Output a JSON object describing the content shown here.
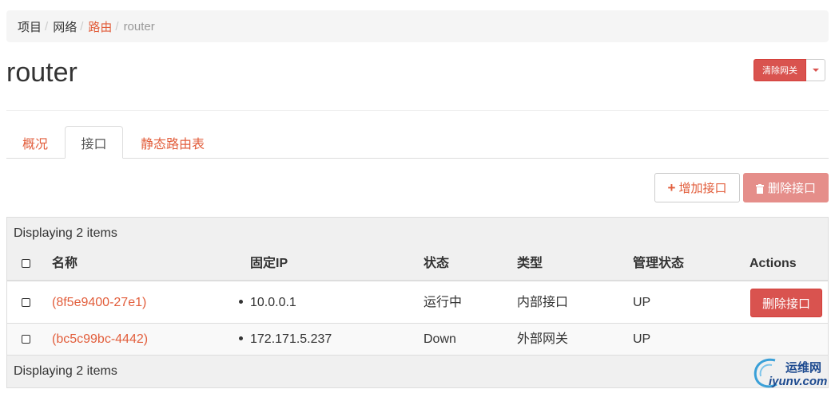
{
  "breadcrumb": {
    "items": [
      "项目",
      "网络",
      "路由",
      "router"
    ],
    "separator": "/"
  },
  "page": {
    "title": "router"
  },
  "header_actions": {
    "clear_gateway_label": "清除网关"
  },
  "tabs": [
    {
      "label": "概况",
      "active": false
    },
    {
      "label": "接口",
      "active": true
    },
    {
      "label": "静态路由表",
      "active": false
    }
  ],
  "toolbar": {
    "add_interface_label": "增加接口",
    "delete_interface_label": "删除接口"
  },
  "table": {
    "caption": "Displaying 2 items",
    "footer": "Displaying 2 items",
    "columns": [
      "名称",
      "固定IP",
      "状态",
      "类型",
      "管理状态",
      "Actions"
    ],
    "rows": [
      {
        "name": "(8f5e9400-27e1)",
        "fixed_ip": "10.0.0.1",
        "status": "运行中",
        "type": "内部接口",
        "admin_state": "UP",
        "action_label": "删除接口"
      },
      {
        "name": "(bc5c99bc-4442)",
        "fixed_ip": "172.171.5.237",
        "status": "Down",
        "type": "外部网关",
        "admin_state": "UP",
        "action_label": ""
      }
    ]
  },
  "watermark": {
    "line1": "运维网",
    "line2": "iyunv.com"
  },
  "colors": {
    "link": "#e25e3c",
    "danger": "#d9534f",
    "danger_disabled": "#e58e8a"
  }
}
